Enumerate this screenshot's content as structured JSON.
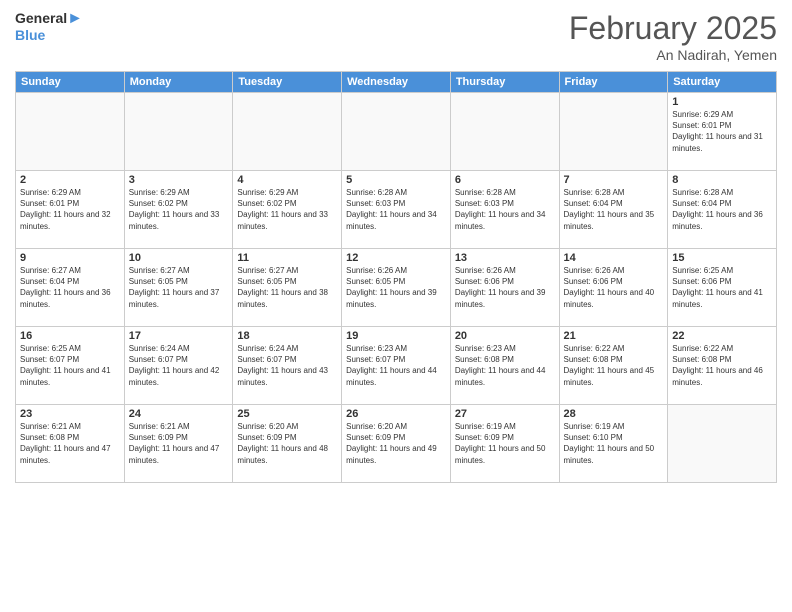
{
  "header": {
    "logo_general": "General",
    "logo_blue": "Blue",
    "title": "February 2025",
    "location": "An Nadirah, Yemen"
  },
  "days_of_week": [
    "Sunday",
    "Monday",
    "Tuesday",
    "Wednesday",
    "Thursday",
    "Friday",
    "Saturday"
  ],
  "weeks": [
    [
      {
        "day": "",
        "info": "",
        "empty": true
      },
      {
        "day": "",
        "info": "",
        "empty": true
      },
      {
        "day": "",
        "info": "",
        "empty": true
      },
      {
        "day": "",
        "info": "",
        "empty": true
      },
      {
        "day": "",
        "info": "",
        "empty": true
      },
      {
        "day": "",
        "info": "",
        "empty": true
      },
      {
        "day": "1",
        "info": "Sunrise: 6:29 AM\nSunset: 6:01 PM\nDaylight: 11 hours and 31 minutes."
      }
    ],
    [
      {
        "day": "2",
        "info": "Sunrise: 6:29 AM\nSunset: 6:01 PM\nDaylight: 11 hours and 32 minutes."
      },
      {
        "day": "3",
        "info": "Sunrise: 6:29 AM\nSunset: 6:02 PM\nDaylight: 11 hours and 33 minutes."
      },
      {
        "day": "4",
        "info": "Sunrise: 6:29 AM\nSunset: 6:02 PM\nDaylight: 11 hours and 33 minutes."
      },
      {
        "day": "5",
        "info": "Sunrise: 6:28 AM\nSunset: 6:03 PM\nDaylight: 11 hours and 34 minutes."
      },
      {
        "day": "6",
        "info": "Sunrise: 6:28 AM\nSunset: 6:03 PM\nDaylight: 11 hours and 34 minutes."
      },
      {
        "day": "7",
        "info": "Sunrise: 6:28 AM\nSunset: 6:04 PM\nDaylight: 11 hours and 35 minutes."
      },
      {
        "day": "8",
        "info": "Sunrise: 6:28 AM\nSunset: 6:04 PM\nDaylight: 11 hours and 36 minutes."
      }
    ],
    [
      {
        "day": "9",
        "info": "Sunrise: 6:27 AM\nSunset: 6:04 PM\nDaylight: 11 hours and 36 minutes."
      },
      {
        "day": "10",
        "info": "Sunrise: 6:27 AM\nSunset: 6:05 PM\nDaylight: 11 hours and 37 minutes."
      },
      {
        "day": "11",
        "info": "Sunrise: 6:27 AM\nSunset: 6:05 PM\nDaylight: 11 hours and 38 minutes."
      },
      {
        "day": "12",
        "info": "Sunrise: 6:26 AM\nSunset: 6:05 PM\nDaylight: 11 hours and 39 minutes."
      },
      {
        "day": "13",
        "info": "Sunrise: 6:26 AM\nSunset: 6:06 PM\nDaylight: 11 hours and 39 minutes."
      },
      {
        "day": "14",
        "info": "Sunrise: 6:26 AM\nSunset: 6:06 PM\nDaylight: 11 hours and 40 minutes."
      },
      {
        "day": "15",
        "info": "Sunrise: 6:25 AM\nSunset: 6:06 PM\nDaylight: 11 hours and 41 minutes."
      }
    ],
    [
      {
        "day": "16",
        "info": "Sunrise: 6:25 AM\nSunset: 6:07 PM\nDaylight: 11 hours and 41 minutes."
      },
      {
        "day": "17",
        "info": "Sunrise: 6:24 AM\nSunset: 6:07 PM\nDaylight: 11 hours and 42 minutes."
      },
      {
        "day": "18",
        "info": "Sunrise: 6:24 AM\nSunset: 6:07 PM\nDaylight: 11 hours and 43 minutes."
      },
      {
        "day": "19",
        "info": "Sunrise: 6:23 AM\nSunset: 6:07 PM\nDaylight: 11 hours and 44 minutes."
      },
      {
        "day": "20",
        "info": "Sunrise: 6:23 AM\nSunset: 6:08 PM\nDaylight: 11 hours and 44 minutes."
      },
      {
        "day": "21",
        "info": "Sunrise: 6:22 AM\nSunset: 6:08 PM\nDaylight: 11 hours and 45 minutes."
      },
      {
        "day": "22",
        "info": "Sunrise: 6:22 AM\nSunset: 6:08 PM\nDaylight: 11 hours and 46 minutes."
      }
    ],
    [
      {
        "day": "23",
        "info": "Sunrise: 6:21 AM\nSunset: 6:08 PM\nDaylight: 11 hours and 47 minutes."
      },
      {
        "day": "24",
        "info": "Sunrise: 6:21 AM\nSunset: 6:09 PM\nDaylight: 11 hours and 47 minutes."
      },
      {
        "day": "25",
        "info": "Sunrise: 6:20 AM\nSunset: 6:09 PM\nDaylight: 11 hours and 48 minutes."
      },
      {
        "day": "26",
        "info": "Sunrise: 6:20 AM\nSunset: 6:09 PM\nDaylight: 11 hours and 49 minutes."
      },
      {
        "day": "27",
        "info": "Sunrise: 6:19 AM\nSunset: 6:09 PM\nDaylight: 11 hours and 50 minutes."
      },
      {
        "day": "28",
        "info": "Sunrise: 6:19 AM\nSunset: 6:10 PM\nDaylight: 11 hours and 50 minutes."
      },
      {
        "day": "",
        "info": "",
        "empty": true
      }
    ]
  ]
}
